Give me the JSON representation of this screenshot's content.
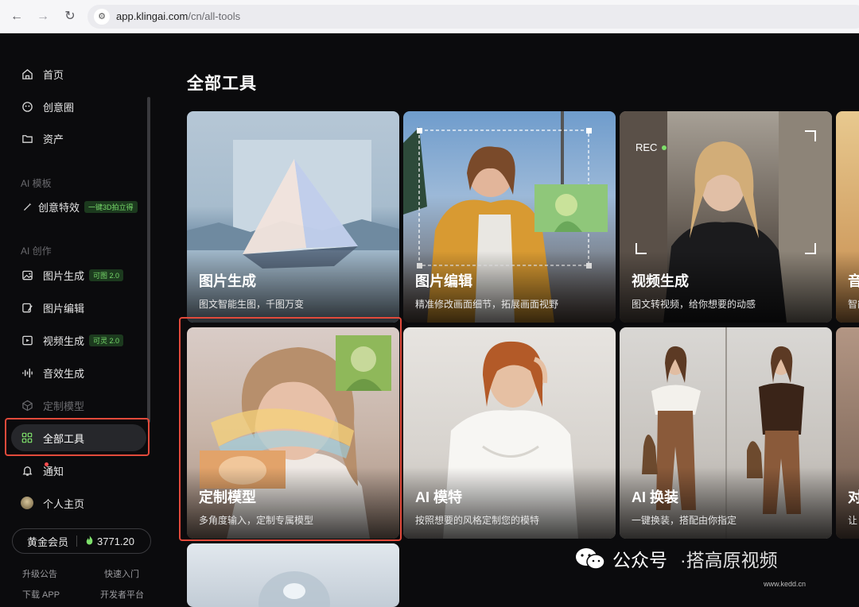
{
  "browser": {
    "url_host": "app.klingai.com",
    "url_path": "/cn/all-tools"
  },
  "sidebar": {
    "items_top": [
      {
        "label": "首页",
        "icon": "home-icon"
      },
      {
        "label": "创意圈",
        "icon": "community-icon"
      },
      {
        "label": "资产",
        "icon": "folder-icon"
      }
    ],
    "section_templates": "AI 模板",
    "effects": {
      "label": "创意特效",
      "tag": "一键3D拍立得",
      "icon": "magic-wand-icon"
    },
    "section_create": "AI 创作",
    "create_items": [
      {
        "label": "图片生成",
        "tag": "可图 2.0",
        "icon": "image-icon"
      },
      {
        "label": "图片编辑",
        "tag": "",
        "icon": "image-edit-icon"
      },
      {
        "label": "视频生成",
        "tag": "可灵 2.0",
        "icon": "video-icon"
      },
      {
        "label": "音效生成",
        "tag": "",
        "icon": "audio-wave-icon"
      },
      {
        "label": "定制模型",
        "tag": "",
        "icon": "cube-icon"
      }
    ],
    "all_tools": {
      "label": "全部工具",
      "icon": "grid-icon"
    },
    "notify": {
      "label": "通知",
      "icon": "bell-icon"
    },
    "profile": {
      "label": "个人主页",
      "icon": "avatar"
    },
    "member": {
      "label": "黄金会员",
      "credits": "3771.20"
    },
    "footer": {
      "left1": "升级公告",
      "right1": "快速入门",
      "left2": "下载 APP",
      "right2": "开发者平台"
    }
  },
  "main": {
    "title": "全部工具",
    "cards": [
      {
        "title": "图片生成",
        "desc": "图文智能生图，千图万变"
      },
      {
        "title": "图片编辑",
        "desc": "精准修改画面细节，拓展画面视野"
      },
      {
        "title": "视频生成",
        "desc": "图文转视频，给你想要的动感",
        "badge": "REC"
      },
      {
        "title": "音",
        "desc": "智能"
      },
      {
        "title": "定制模型",
        "desc": "多角度输入，定制专属模型"
      },
      {
        "title": "AI 模特",
        "desc": "按照想要的风格定制您的模特"
      },
      {
        "title": "AI 换装",
        "desc": "一键换装，搭配由你指定"
      },
      {
        "title": "对",
        "desc": "让"
      }
    ]
  },
  "watermark": {
    "label": "公众号",
    "brand": "·搭高原视频",
    "url": "www.kedd.cn"
  },
  "colors": {
    "accent": "#7ee06b",
    "highlight": "#e24a3b",
    "bg": "#0b0b0d"
  }
}
